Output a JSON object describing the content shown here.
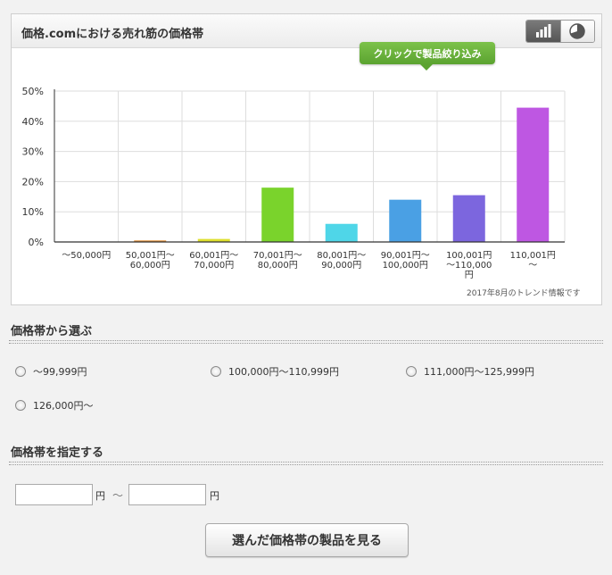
{
  "panel": {
    "title": "価格.comにおける売れ筋の価格帯",
    "tooltip": "クリックで製品絞り込み",
    "trend_note": "2017年8月のトレンド情報です",
    "view_toggle": {
      "bar_icon": "bar-chart-icon",
      "pie_icon": "pie-chart-icon",
      "active": "bar"
    }
  },
  "chart_data": {
    "type": "bar",
    "categories": [
      [
        "～50,000円"
      ],
      [
        "50,001円～",
        "60,000円"
      ],
      [
        "60,001円～",
        "70,000円"
      ],
      [
        "70,001円～",
        "80,000円"
      ],
      [
        "80,001円～",
        "90,000円"
      ],
      [
        "90,001円～",
        "100,000円"
      ],
      [
        "100,001円",
        "～110,000",
        "円"
      ],
      [
        "110,001円",
        "～"
      ]
    ],
    "values": [
      0,
      0.5,
      1,
      18,
      6,
      14,
      15.5,
      44.5
    ],
    "colors": [
      "#999999",
      "#e08a2e",
      "#dfe030",
      "#7ad32c",
      "#4fd6e8",
      "#4aa0e4",
      "#7c66de",
      "#be57e2"
    ],
    "ylim": [
      0,
      50
    ],
    "yticks": [
      "0%",
      "10%",
      "20%",
      "30%",
      "40%",
      "50%"
    ],
    "grid": true,
    "title": "",
    "xlabel": "",
    "ylabel": ""
  },
  "select_section": {
    "heading": "価格帯から選ぶ",
    "options": [
      "～99,999円",
      "100,000円～110,999円",
      "111,000円～125,999円",
      "126,000円～"
    ]
  },
  "range_section": {
    "heading": "価格帯を指定する",
    "min_value": "",
    "max_value": "",
    "unit": "円",
    "separator": "～"
  },
  "submit_label": "選んだ価格帯の製品を見る"
}
